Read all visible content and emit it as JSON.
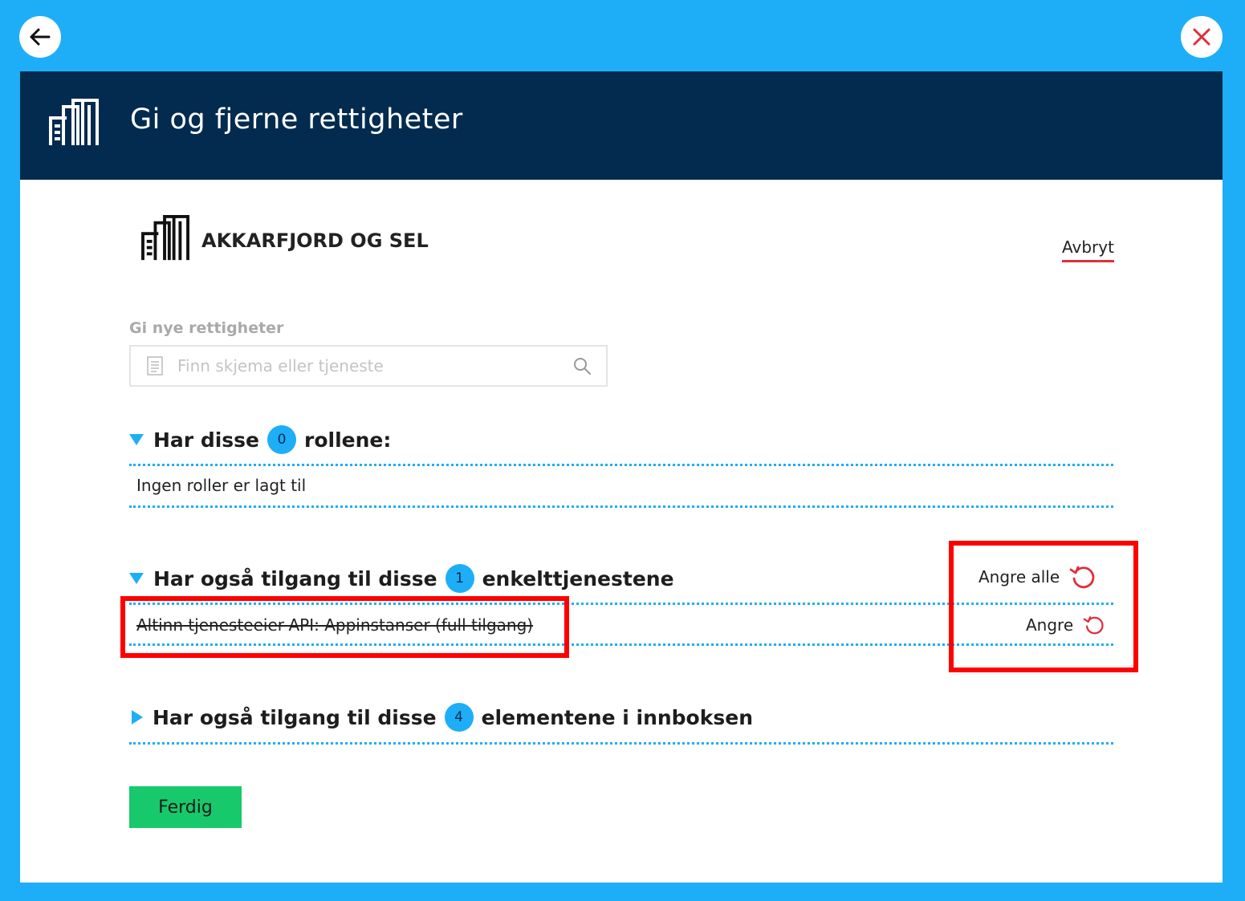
{
  "nav": {
    "back_icon": "arrow-left-icon",
    "close_icon": "close-x-icon",
    "close_color": "#e02e3d"
  },
  "header": {
    "title": "Gi og fjerne rettigheter",
    "icon": "building-icon",
    "background": "#022b4f"
  },
  "org": {
    "name": "AKKARFJORD OG SEL",
    "cancel_label": "Avbryt"
  },
  "search": {
    "label": "Gi nye rettigheter",
    "placeholder": "Finn skjema eller tjeneste"
  },
  "sections": {
    "roles": {
      "prefix": "Har disse",
      "count": "0",
      "suffix": "rollene:",
      "expanded": true,
      "empty_text": "Ingen roller er lagt til"
    },
    "services": {
      "prefix": "Har også tilgang til disse",
      "count": "1",
      "suffix": "enkelttjenestene",
      "expanded": true,
      "undo_all_label": "Angre alle",
      "items": [
        {
          "name": "Altinn tjenesteeier-API: Appinstanser (full tilgang)",
          "struck_through": true,
          "undo_label": "Angre"
        }
      ]
    },
    "inbox": {
      "prefix": "Har også tilgang til disse",
      "count": "4",
      "suffix": "elementene i innboksen",
      "expanded": false
    }
  },
  "done_label": "Ferdig",
  "colors": {
    "accent": "#1eaef7",
    "done": "#17c96b",
    "annotation": "#ff0000",
    "undo": "#e02e3d"
  }
}
